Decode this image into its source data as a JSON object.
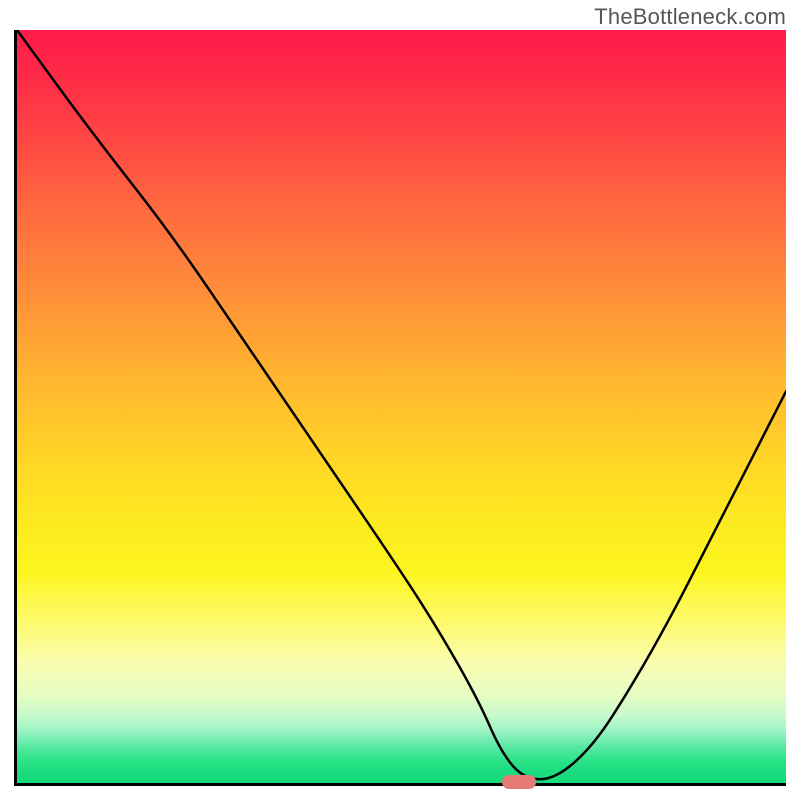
{
  "watermark": "TheBottleneck.com",
  "chart_data": {
    "type": "line",
    "title": "",
    "xlabel": "",
    "ylabel": "",
    "xlim": [
      0,
      100
    ],
    "ylim": [
      0,
      100
    ],
    "x": [
      0,
      10,
      20,
      30,
      40,
      50,
      55,
      60,
      63,
      66,
      70,
      75,
      80,
      85,
      90,
      95,
      100
    ],
    "values": [
      100,
      86,
      73,
      58,
      43,
      28,
      20,
      11,
      4,
      0.5,
      0.5,
      5,
      13,
      22,
      32,
      42,
      52
    ],
    "marker": {
      "x": 65,
      "y": 0.5
    },
    "gradient_note": "vertical gradient red(top)->orange->yellow->pale-yellow->green(bottom)"
  }
}
